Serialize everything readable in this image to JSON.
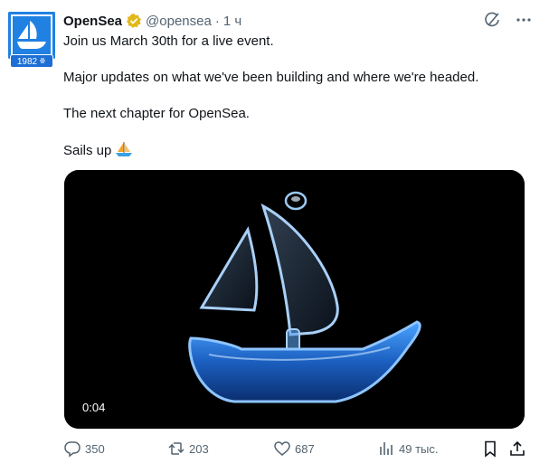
{
  "account": {
    "display_name": "OpenSea",
    "handle": "@opensea",
    "separator": "·",
    "time": "1 ч",
    "badge_year": "1982"
  },
  "post": {
    "paragraphs": [
      "Join us March 30th for a live event.",
      "Major updates on what we've been building and where we're headed.",
      "The next chapter for OpenSea.",
      "Sails up"
    ],
    "emoji": "sailboat"
  },
  "media": {
    "video_time": "0:04"
  },
  "actions": {
    "replies": "350",
    "reposts": "203",
    "likes": "687",
    "views": "49 тыс."
  },
  "icons": {
    "verified": "verified-gold-badge-icon",
    "grok": "grok-icon",
    "more": "more-icon",
    "reply": "reply-icon",
    "repost": "repost-icon",
    "like": "heart-icon",
    "views": "views-chart-icon",
    "bookmark": "bookmark-icon",
    "share": "share-icon"
  },
  "colors": {
    "brand_blue": "#2081e2",
    "verified_gold": "#e2b719",
    "muted_text": "#536471"
  }
}
